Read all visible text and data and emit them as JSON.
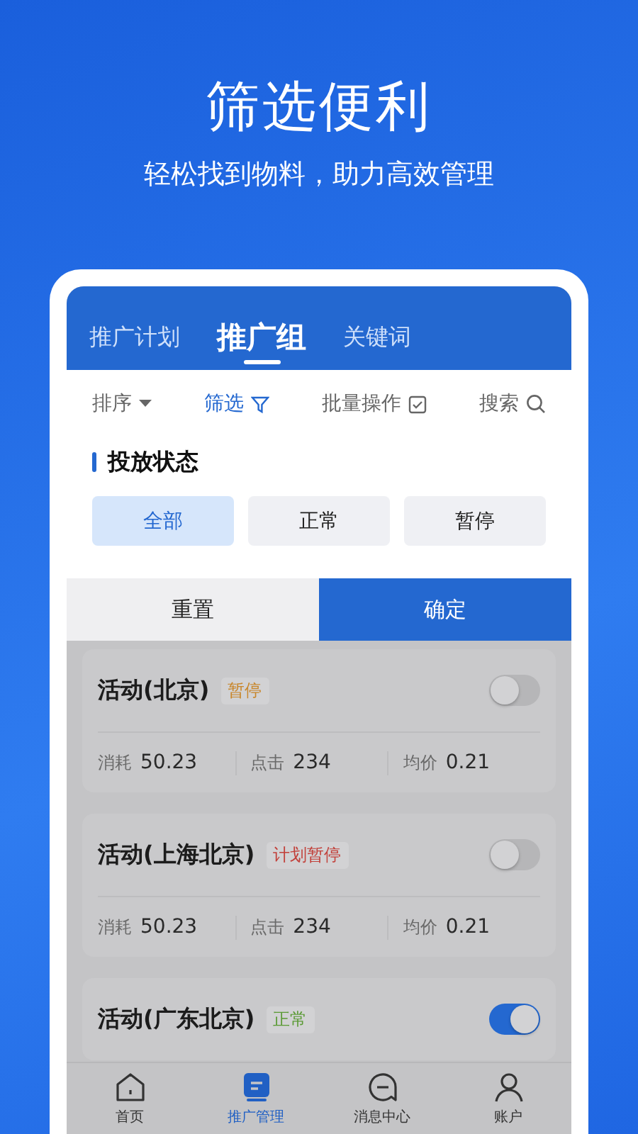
{
  "headline": "筛选便利",
  "subheadline": "轻松找到物料，助力高效管理",
  "tabs": [
    {
      "label": "推广计划",
      "selected": false
    },
    {
      "label": "推广组",
      "selected": true
    },
    {
      "label": "关键词",
      "selected": false
    }
  ],
  "toolbar": [
    {
      "label": "排序",
      "kind": "sort",
      "selected": false
    },
    {
      "label": "筛选",
      "kind": "filter",
      "selected": true
    },
    {
      "label": "批量操作",
      "kind": "batch",
      "selected": false
    },
    {
      "label": "搜索",
      "kind": "search",
      "selected": false
    }
  ],
  "section_title": "投放状态",
  "status_options": [
    {
      "label": "全部",
      "selected": true
    },
    {
      "label": "正常",
      "selected": false
    },
    {
      "label": "暂停",
      "selected": false
    }
  ],
  "reset_button": "重置",
  "confirm_button": "确定",
  "campaigns": [
    {
      "name": "活动(北京)",
      "status": "暂停",
      "color": "#c8862a",
      "on": false,
      "stats": [
        {
          "label": "消耗",
          "value": "50.23"
        },
        {
          "label": "点击",
          "value": "234"
        },
        {
          "label": "均价",
          "value": "0.21"
        }
      ]
    },
    {
      "name": "活动(上海北京)",
      "status": "计划暂停",
      "color": "#c2403a",
      "on": false,
      "stats": [
        {
          "label": "消耗",
          "value": "50.23"
        },
        {
          "label": "点击",
          "value": "234"
        },
        {
          "label": "均价",
          "value": "0.21"
        }
      ]
    },
    {
      "name": "活动(广东北京)",
      "status": "正常",
      "color": "#5a9a34",
      "on": true
    }
  ],
  "nav": [
    {
      "label": "首页",
      "kind": "home",
      "selected": false
    },
    {
      "label": "推广管理",
      "kind": "manage",
      "selected": true
    },
    {
      "label": "消息中心",
      "kind": "message",
      "selected": false
    },
    {
      "label": "账户",
      "kind": "account",
      "selected": false
    }
  ]
}
